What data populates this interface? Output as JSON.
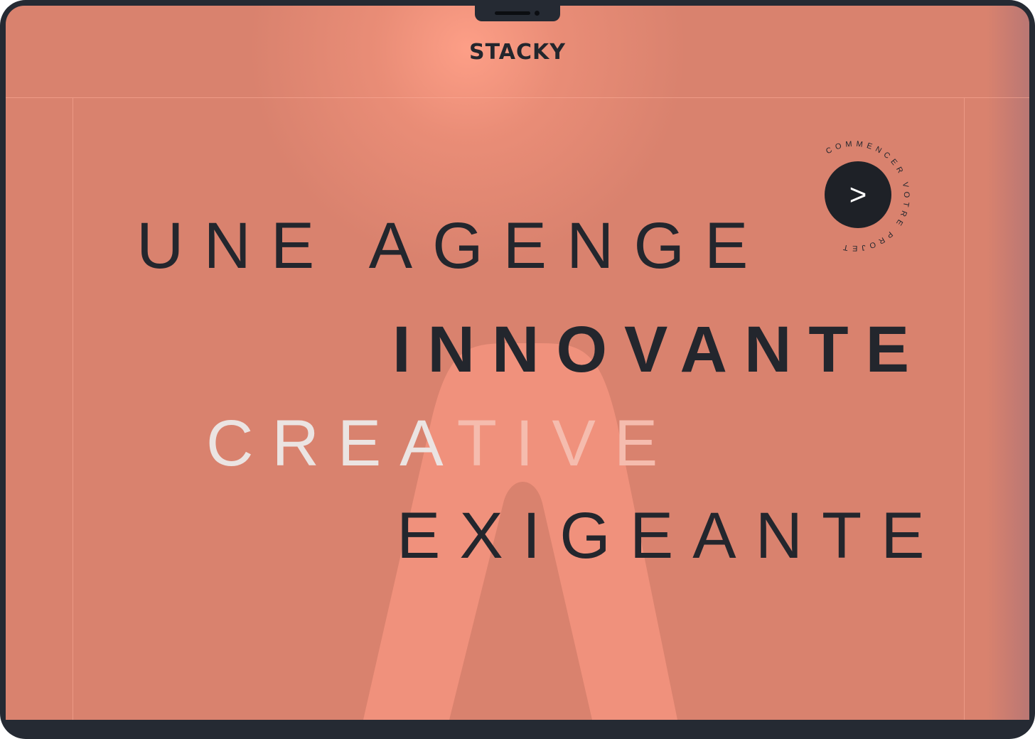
{
  "header": {
    "logo_text": "STACKY"
  },
  "hero": {
    "line1": "UNE AGENGE",
    "line2": "INNOVANTE",
    "line3_part1": "CREA",
    "line3_part2": "TIVE",
    "line4": "EXIGEANTE"
  },
  "cta_badge": {
    "circular_text": "COMMENCER VOTRE PROJET",
    "arrow": ">"
  },
  "colors": {
    "background": "#d9826e",
    "arch": "#f0917c",
    "text_dark": "#23262d",
    "text_light": "#ebe4e2",
    "frame": "#252a33"
  }
}
